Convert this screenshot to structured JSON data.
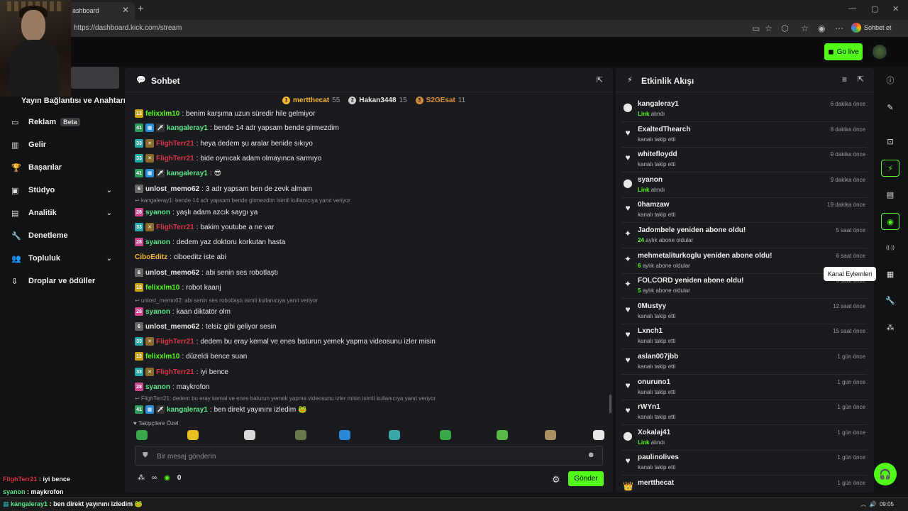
{
  "browser": {
    "tab_title": "ashboard",
    "url": "https://dashboard.kick.com/stream",
    "sohbet_et": "Sohbet et"
  },
  "topnav": {
    "go_live": "Go live"
  },
  "sidebar": {
    "header": "Yayın Bağlantısı ve Anahtarı",
    "items": [
      {
        "icon": "▭",
        "label": "Reklam",
        "badge": "Beta",
        "chevron": false
      },
      {
        "icon": "▥",
        "label": "Gelir",
        "badge": "",
        "chevron": false
      },
      {
        "icon": "🏆",
        "label": "Başarılar",
        "badge": "",
        "chevron": false
      },
      {
        "icon": "▣",
        "label": "Stüdyo",
        "badge": "",
        "chevron": true
      },
      {
        "icon": "▤",
        "label": "Analitik",
        "badge": "",
        "chevron": true
      },
      {
        "icon": "🔧",
        "label": "Denetleme",
        "badge": "",
        "chevron": false
      },
      {
        "icon": "👥",
        "label": "Topluluk",
        "badge": "",
        "chevron": true
      },
      {
        "icon": "⇩",
        "label": "Droplar ve ödüller",
        "badge": "",
        "chevron": false
      }
    ]
  },
  "chat": {
    "title": "Sohbet",
    "top_gifters": [
      {
        "rank": "1",
        "name": "mertthecat",
        "count": "55",
        "color": "#f5b533",
        "medal": "#f5b533"
      },
      {
        "rank": "2",
        "name": "Hakan3448",
        "count": "15",
        "color": "#e8e8e8",
        "medal": "#cfcfcf"
      },
      {
        "rank": "3",
        "name": "S2GEsat",
        "count": "11",
        "color": "#e0903a",
        "medal": "#d08a3a"
      }
    ],
    "messages": [
      {
        "kind": "msg",
        "badges": [
          {
            "text": "13",
            "color": "#c9a012"
          }
        ],
        "user": "felixxlm10",
        "user_color": "#53fc18",
        "text": "benim karşıma uzun süredir hile gelmiyor"
      },
      {
        "kind": "msg",
        "badges": [
          {
            "text": "41",
            "color": "#2e9a5a"
          },
          {
            "text": "▦",
            "color": "#2a8cd8"
          },
          {
            "text": "🗡",
            "color": "#333"
          }
        ],
        "user": "kangaleray1",
        "user_color": "#5ce58a",
        "text": "bende 14 adr yapsam bende girmezdim"
      },
      {
        "kind": "msg",
        "badges": [
          {
            "text": "33",
            "color": "#2aa8a8"
          },
          {
            "text": "✕",
            "color": "#8a6a2a"
          }
        ],
        "user": "FlighTerr21",
        "user_color": "#d8344a",
        "text": "heya dedem şu aralar benide sıkıyo"
      },
      {
        "kind": "msg",
        "badges": [
          {
            "text": "33",
            "color": "#2aa8a8"
          },
          {
            "text": "✕",
            "color": "#8a6a2a"
          }
        ],
        "user": "FlighTerr21",
        "user_color": "#d8344a",
        "text": "bide oynıcak adam olmayınca sarmıyo"
      },
      {
        "kind": "msg",
        "badges": [
          {
            "text": "41",
            "color": "#2e9a5a"
          },
          {
            "text": "▦",
            "color": "#2a8cd8"
          },
          {
            "text": "🗡",
            "color": "#333"
          }
        ],
        "user": "kangaleray1",
        "user_color": "#5ce58a",
        "text": "😎"
      },
      {
        "kind": "msg",
        "badges": [
          {
            "text": "6",
            "color": "#666"
          }
        ],
        "user": "unlost_memo62",
        "user_color": "#e8e8e8",
        "text": "3 adr yapsam ben de zevk almam"
      },
      {
        "kind": "reply",
        "text": "↩ kangaleray1: bende 14 adr yapsam bende girmezdim isimli kullanıcıya yanıt veriyor"
      },
      {
        "kind": "msg",
        "badges": [
          {
            "text": "28",
            "color": "#c8468a"
          }
        ],
        "user": "syanon",
        "user_color": "#5ce58a",
        "text": "yaşlı adam azcık saygı ya"
      },
      {
        "kind": "msg",
        "badges": [
          {
            "text": "33",
            "color": "#2aa8a8"
          },
          {
            "text": "✕",
            "color": "#8a6a2a"
          }
        ],
        "user": "FlighTerr21",
        "user_color": "#d8344a",
        "text": "bakim youtube a ne var"
      },
      {
        "kind": "msg",
        "badges": [
          {
            "text": "28",
            "color": "#c8468a"
          }
        ],
        "user": "syanon",
        "user_color": "#5ce58a",
        "text": "dedem yaz doktoru korkutan hasta"
      },
      {
        "kind": "msg",
        "badges": [],
        "user": "CiboEditz",
        "user_color": "#f5b533",
        "text": "ciboeditz iste abi"
      },
      {
        "kind": "msg",
        "badges": [
          {
            "text": "6",
            "color": "#666"
          }
        ],
        "user": "unlost_memo62",
        "user_color": "#e8e8e8",
        "text": "abi senin ses robotlaştı"
      },
      {
        "kind": "msg",
        "badges": [
          {
            "text": "13",
            "color": "#c9a012"
          }
        ],
        "user": "felixxlm10",
        "user_color": "#53fc18",
        "text": "robot kaanj"
      },
      {
        "kind": "reply",
        "text": "↩ unlost_memo62: abi senin ses robotlaştı isimli kullanıcıya yanıt veriyor"
      },
      {
        "kind": "msg",
        "badges": [
          {
            "text": "28",
            "color": "#c8468a"
          }
        ],
        "user": "syanon",
        "user_color": "#5ce58a",
        "text": "kaan diktatör olm"
      },
      {
        "kind": "msg",
        "badges": [
          {
            "text": "6",
            "color": "#666"
          }
        ],
        "user": "unlost_memo62",
        "user_color": "#e8e8e8",
        "text": "telsiz gibi geliyor sesin"
      },
      {
        "kind": "msg",
        "badges": [
          {
            "text": "33",
            "color": "#2aa8a8"
          },
          {
            "text": "✕",
            "color": "#8a6a2a"
          }
        ],
        "user": "FlighTerr21",
        "user_color": "#d8344a",
        "text": "dedem bu eray kemal ve enes baturun yemek yapma videosunu izler misin"
      },
      {
        "kind": "msg",
        "badges": [
          {
            "text": "13",
            "color": "#c9a012"
          }
        ],
        "user": "felixxlm10",
        "user_color": "#53fc18",
        "text": "düzeldi bence suan"
      },
      {
        "kind": "msg",
        "badges": [
          {
            "text": "33",
            "color": "#2aa8a8"
          },
          {
            "text": "✕",
            "color": "#8a6a2a"
          }
        ],
        "user": "FlighTerr21",
        "user_color": "#d8344a",
        "text": "iyi bence"
      },
      {
        "kind": "msg",
        "badges": [
          {
            "text": "28",
            "color": "#c8468a"
          }
        ],
        "user": "syanon",
        "user_color": "#5ce58a",
        "text": "maykrofon"
      },
      {
        "kind": "reply",
        "text": "↩ FlighTerr21: dedem bu eray kemal ve enes baturun yemek yapma videosunu izler misin isimli kullanıcıya yanıt veriyor"
      },
      {
        "kind": "msg",
        "badges": [
          {
            "text": "41",
            "color": "#2e9a5a"
          },
          {
            "text": "▦",
            "color": "#2a8cd8"
          },
          {
            "text": "🗡",
            "color": "#333"
          }
        ],
        "user": "kangaleray1",
        "user_color": "#5ce58a",
        "text": "ben direkt yayınını izledim 🐸"
      }
    ],
    "followers_only_label": "♥ Takipçilere Özel",
    "input_placeholder": "Bir mesaj gönderin",
    "infinity_symbol": "∞",
    "points": "0",
    "send": "Gönder"
  },
  "activity": {
    "title": "Etkinlik Akışı",
    "events": [
      {
        "type": "sub",
        "icon": "⬤",
        "name": "kangaleray1",
        "detail_hl": "Link",
        "detail": "alındı",
        "time": "6 dakika önce"
      },
      {
        "type": "follow",
        "icon": "♥",
        "name": "ExaltedThearch",
        "detail_hl": "",
        "detail": "kanalı takip etti",
        "time": "8 dakika önce"
      },
      {
        "type": "follow",
        "icon": "♥",
        "name": "whitefloydd",
        "detail_hl": "",
        "detail": "kanalı takip etti",
        "time": "9 dakika önce"
      },
      {
        "type": "sub",
        "icon": "⬤",
        "name": "syanon",
        "detail_hl": "Link",
        "detail": "alındı",
        "time": "9 dakika önce"
      },
      {
        "type": "follow",
        "icon": "♥",
        "name": "0hamzaw",
        "detail_hl": "",
        "detail": "kanalı takip etti",
        "time": "19 dakika önce"
      },
      {
        "type": "resub",
        "icon": "✦",
        "name": "Jadombele yeniden abone oldu!",
        "detail_hl": "24",
        "detail": "aylık abone oldular",
        "time": "5 saat önce"
      },
      {
        "type": "resub",
        "icon": "✦",
        "name": "mehmetaliturkoglu yeniden abone oldu!",
        "detail_hl": "6",
        "detail": "aylık abone oldular",
        "time": "6 saat önce"
      },
      {
        "type": "resub",
        "icon": "✦",
        "name": "FOLCORD yeniden abone oldu!",
        "detail_hl": "5",
        "detail": "aylık abone oldular",
        "time": "6 saat önce"
      },
      {
        "type": "follow",
        "icon": "♥",
        "name": "0Mustyy",
        "detail_hl": "",
        "detail": "kanalı takip etti",
        "time": "12 saat önce"
      },
      {
        "type": "follow",
        "icon": "♥",
        "name": "Lxnch1",
        "detail_hl": "",
        "detail": "kanalı takip etti",
        "time": "15 saat önce"
      },
      {
        "type": "follow",
        "icon": "♥",
        "name": "aslan007jbb",
        "detail_hl": "",
        "detail": "kanalı takip etti",
        "time": "1 gün önce"
      },
      {
        "type": "follow",
        "icon": "♥",
        "name": "onuruno1",
        "detail_hl": "",
        "detail": "kanalı takip etti",
        "time": "1 gün önce"
      },
      {
        "type": "follow",
        "icon": "♥",
        "name": "rWYn1",
        "detail_hl": "",
        "detail": "kanalı takip etti",
        "time": "1 gün önce"
      },
      {
        "type": "sub",
        "icon": "⬤",
        "name": "Xokalaj41",
        "detail_hl": "Link",
        "detail": "alındı",
        "time": "1 gün önce"
      },
      {
        "type": "follow",
        "icon": "♥",
        "name": "paulinolives",
        "detail_hl": "",
        "detail": "kanalı takip etti",
        "time": "1 gün önce"
      },
      {
        "type": "gift",
        "icon": "👑",
        "name": "mertthecat",
        "detail_hl": "",
        "detail": "",
        "time": "1 gün önce"
      }
    ]
  },
  "rail": {
    "icons": [
      {
        "name": "info-icon",
        "glyph": "ⓘ",
        "active": false
      },
      {
        "name": "edit-icon",
        "glyph": "✎",
        "active": false
      },
      {
        "name": "camera-icon",
        "glyph": "⊡",
        "active": false
      },
      {
        "name": "lightning-icon",
        "glyph": "⚡",
        "active": true
      },
      {
        "name": "document-icon",
        "glyph": "▤",
        "active": false
      },
      {
        "name": "chat-icon",
        "glyph": "◉",
        "active": true
      },
      {
        "name": "broadcast-icon",
        "glyph": "((·))",
        "active": false
      },
      {
        "name": "channel-actions-icon",
        "glyph": "▦",
        "active": false
      },
      {
        "name": "wrench-icon",
        "glyph": "🔧",
        "active": false
      },
      {
        "name": "nodes-icon",
        "glyph": "⁂",
        "active": false
      }
    ],
    "tooltip": "Kanal Eylemleri"
  },
  "overlay": {
    "lines": [
      {
        "user": "FlighTerr21",
        "color": "#d8344a",
        "sep": " : ",
        "text": "iyi bence"
      },
      {
        "user": "syanon",
        "color": "#5ce58a",
        "sep": " : ",
        "text": "maykrofon"
      }
    ],
    "taskbar_user": "kangaleray1",
    "taskbar_sep": " : ",
    "taskbar_text": "ben direkt yayınını izledim",
    "clock": "09:05"
  }
}
